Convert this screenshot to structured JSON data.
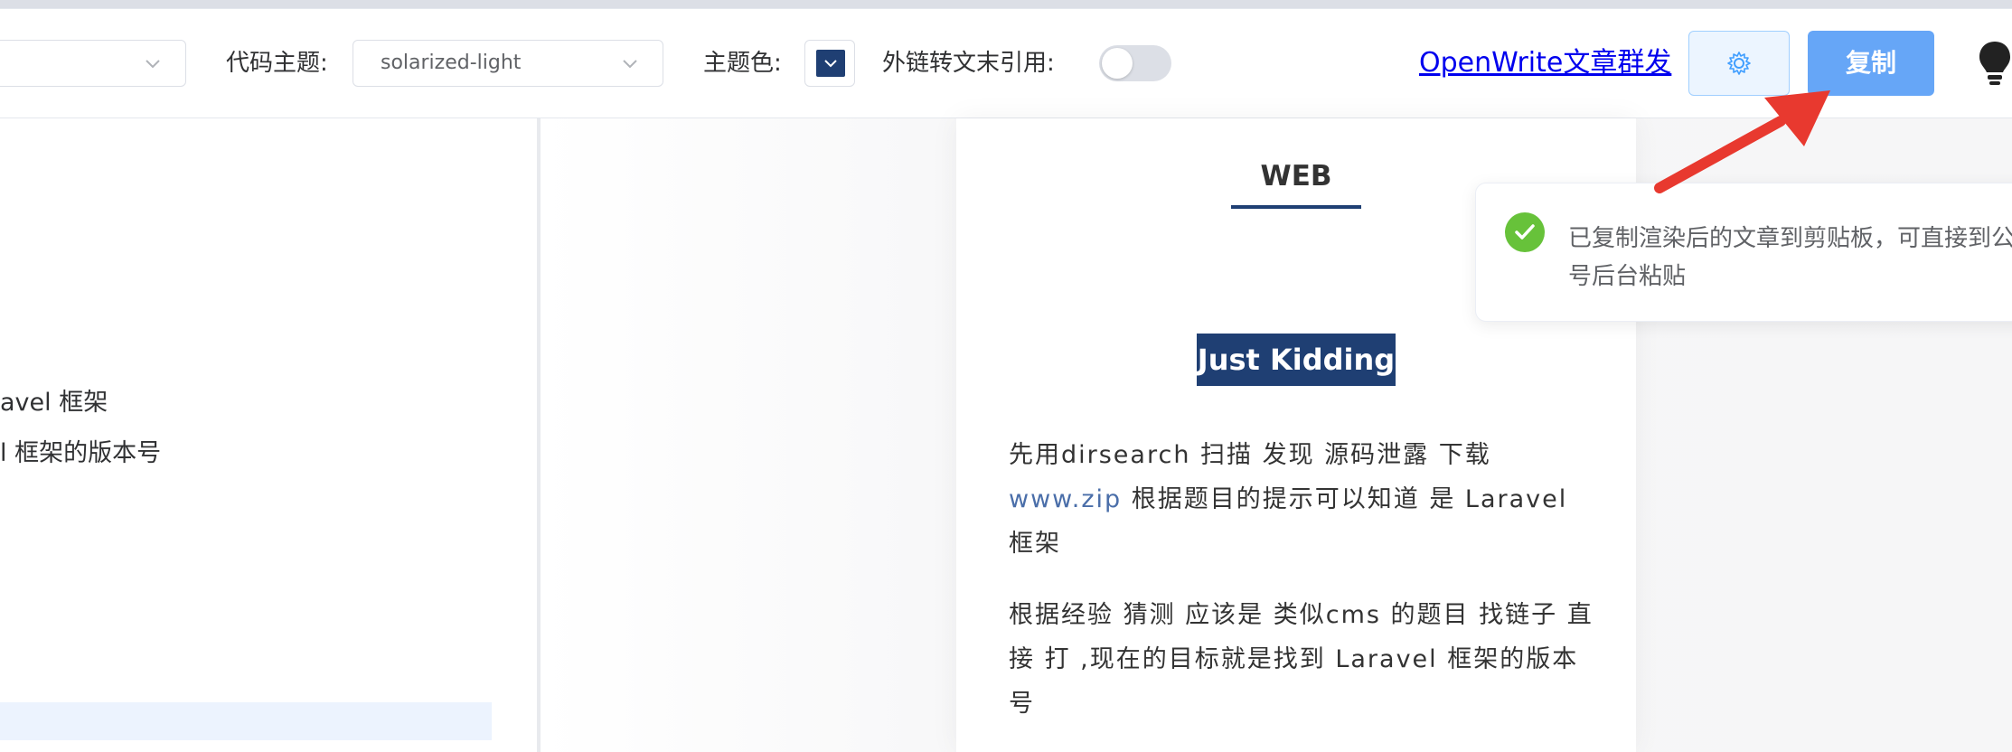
{
  "toolbar": {
    "code_theme_label": "代码主题:",
    "code_theme_value": "solarized-light",
    "theme_color_label": "主题色:",
    "theme_color": "#1f3f73",
    "link_footnote_label": "外链转文末引用:",
    "openwrite_link": "OpenWrite文章群发",
    "copy_button": "复制",
    "settings_icon": "gear-icon",
    "bulb_icon": "bulb-icon"
  },
  "editor": {
    "line1": "avel 框架",
    "line2": "l  框架的版本号"
  },
  "article": {
    "heading_web": "WEB",
    "heading_jk": "Just Kidding",
    "p1_a": "先用dirsearch 扫描 发现 源码泄露 下载 ",
    "p1_link": "www.zip",
    "p1_b": " 根据题目的提示可以知道 是 Laravel 框架",
    "p2": "根据经验 猜测 应该是 类似cms 的题目 找链子 直接 打 ,现在的目标就是找到 Laravel 框架的版本号"
  },
  "toast": {
    "message": "已复制渲染后的文章到剪贴板，可直接到公众号后台粘贴"
  },
  "colors": {
    "accent": "#1f3f73",
    "primary_button": "#66a6f7",
    "success": "#67c23a",
    "arrow": "#e8392f"
  }
}
